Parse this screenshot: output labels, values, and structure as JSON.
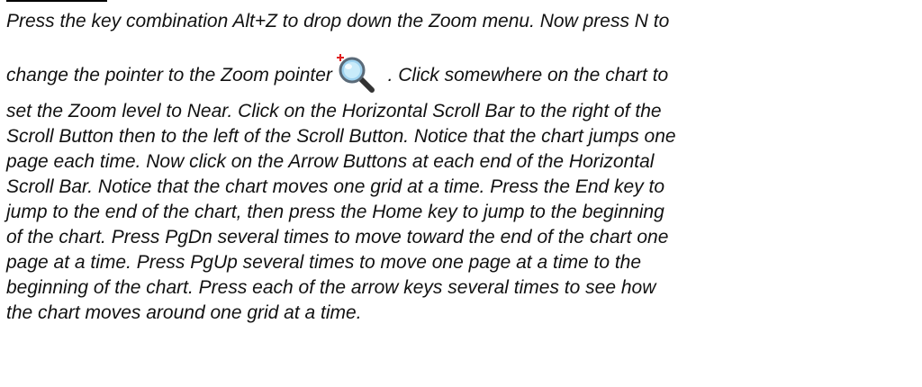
{
  "instructions": {
    "line1": "Press the key combination Alt+Z to drop down the Zoom menu.  Now press N to",
    "line2_before_icon": "change the pointer to the Zoom pointer",
    "line2_after_icon": " .  Click somewhere on the chart to",
    "line3": "set the Zoom level to Near.  Click on the Horizontal Scroll Bar to the right of the",
    "line4": "Scroll Button then to the left of the Scroll Button.  Notice that the chart jumps one",
    "line5": "page each time.  Now click on the Arrow Buttons at each end of the Horizontal",
    "line6": "Scroll Bar.  Notice that the chart moves one grid at a time.  Press the End key to",
    "line7": "jump to the end of the chart, then press the Home key to jump to the beginning",
    "line8": "of the chart.  Press PgDn several times to move toward the end of the chart one",
    "line9": "page at a time.  Press PgUp several times to move one page at a time to the",
    "line10": "beginning of the chart.  Press each of the arrow keys several times to see how",
    "line11": "the chart moves around one grid at a time."
  },
  "icons": {
    "zoom_pointer": "zoom-pointer-icon"
  },
  "colors": {
    "text": "#111111",
    "icon_plus": "#e02020",
    "icon_lens": "#7fc4ea",
    "icon_handle": "#333333"
  }
}
